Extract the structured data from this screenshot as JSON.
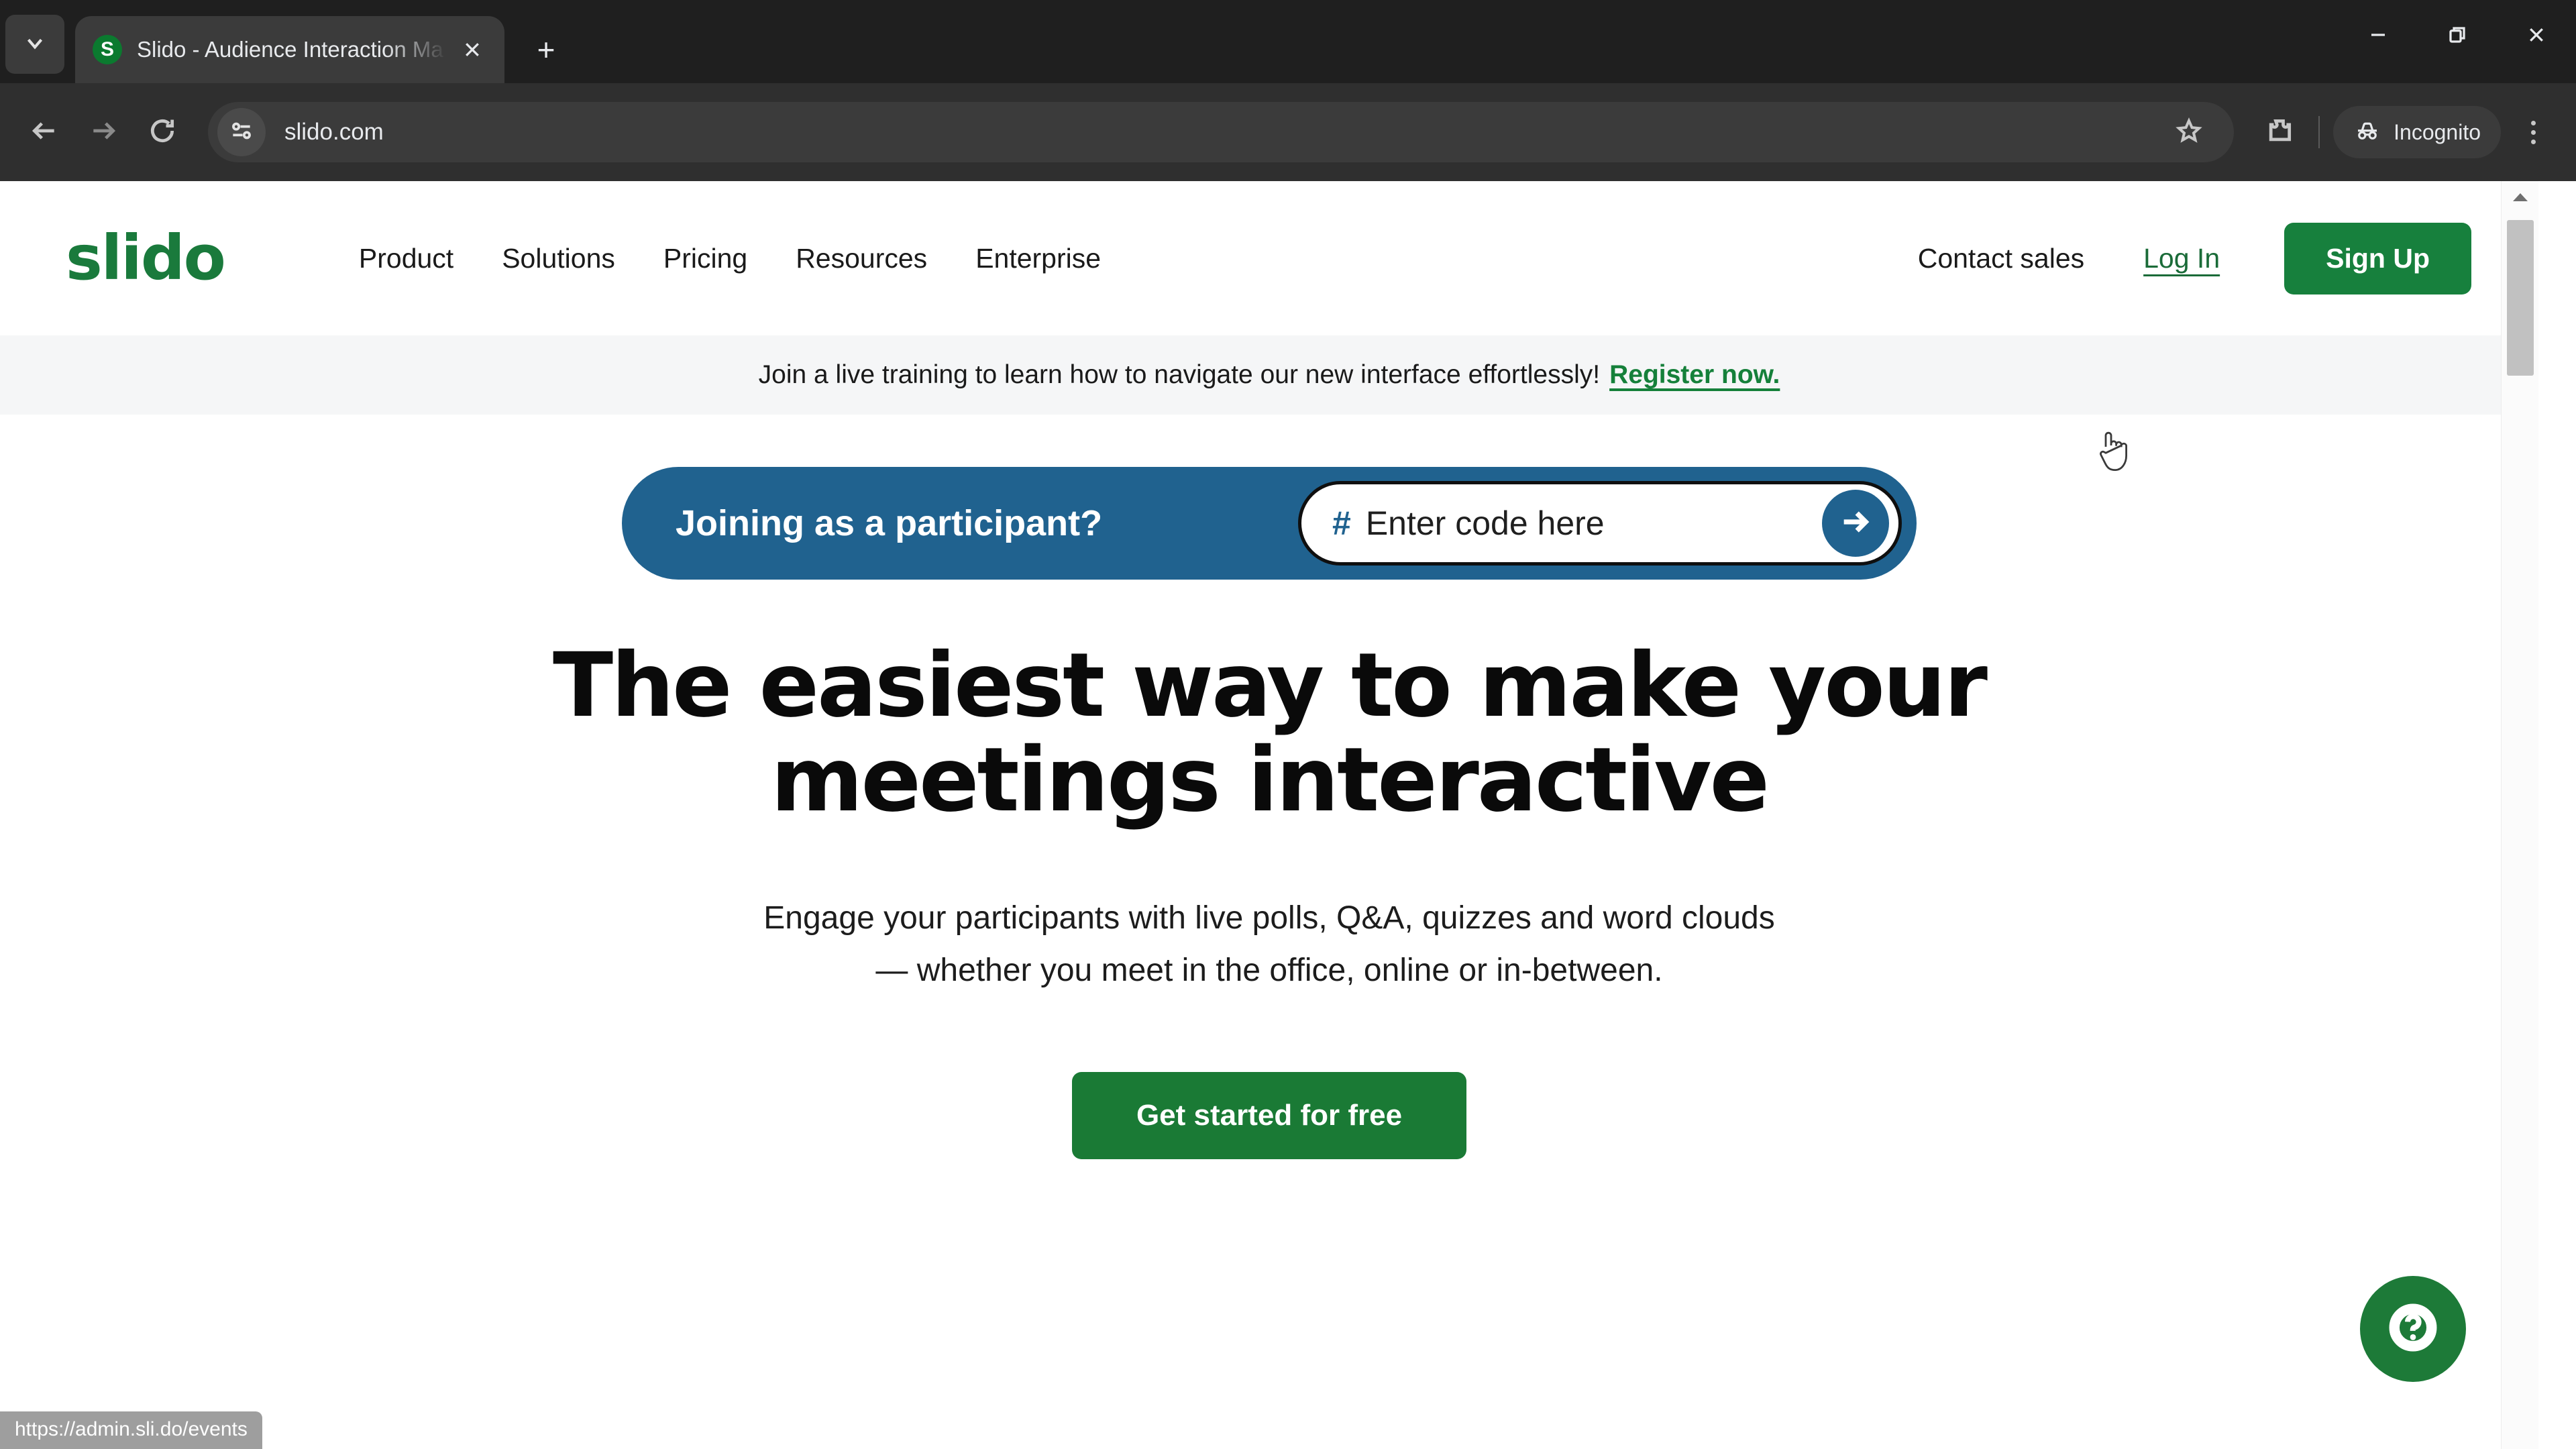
{
  "browser": {
    "tab_search_icon": "chevron-down-icon",
    "tab": {
      "favicon_letter": "S",
      "title": "Slido - Audience Interaction Ma",
      "close_icon": "close-icon"
    },
    "new_tab_label": "+",
    "window_controls": {
      "minimize": "minimize-icon",
      "maximize": "restore-icon",
      "close": "close-icon"
    },
    "toolbar": {
      "back_icon": "back-arrow-icon",
      "forward_icon": "forward-arrow-icon",
      "reload_icon": "reload-icon",
      "site_info_icon": "tune-sliders-icon",
      "url": "slido.com",
      "bookmark_icon": "star-icon",
      "extensions_icon": "puzzle-piece-icon",
      "incognito_label": "Incognito",
      "incognito_icon": "incognito-spy-icon",
      "menu_icon": "kebab-menu-icon"
    },
    "status_url": "https://admin.sli.do/events"
  },
  "site": {
    "logo_text": "slido",
    "nav_items": [
      {
        "label": "Product"
      },
      {
        "label": "Solutions"
      },
      {
        "label": "Pricing"
      },
      {
        "label": "Resources"
      },
      {
        "label": "Enterprise"
      }
    ],
    "contact_sales": "Contact sales",
    "log_in": "Log In",
    "sign_up": "Sign Up",
    "announcement": {
      "text": "Join a live training to learn how to navigate our new interface effortlessly!",
      "link": "Register now."
    },
    "join": {
      "label": "Joining as a participant?",
      "hash_icon": "hash-icon",
      "placeholder": "Enter code here",
      "submit_icon": "arrow-right-icon"
    },
    "hero": {
      "headline": "The easiest way to make your meetings interactive",
      "subhead_line1": "Engage your participants with live polls, Q&A, quizzes and word clouds",
      "subhead_line2": "— whether you meet in the office, online or in-between.",
      "cta": "Get started for free"
    },
    "help_icon": "question-mark-circle-icon"
  },
  "colors": {
    "brand_green": "#17803d",
    "logo_green": "#1a7a3c",
    "join_blue": "#20628f",
    "link_green": "#15803a",
    "banner_bg": "#f5f6f7"
  }
}
